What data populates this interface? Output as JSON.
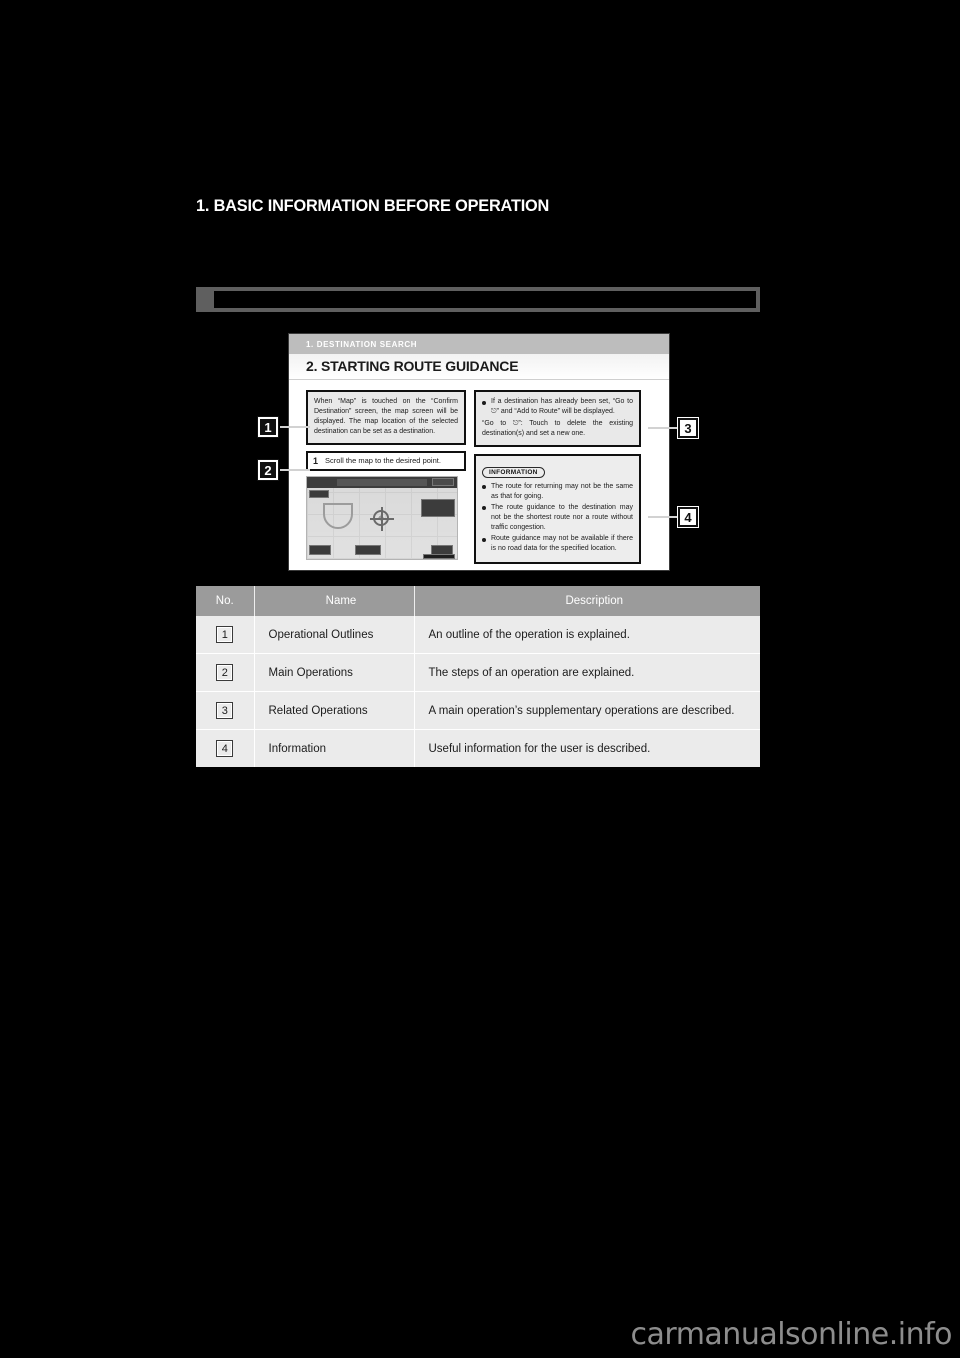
{
  "page": {
    "chapter_title": "1. BASIC INFORMATION BEFORE OPERATION",
    "section_heading": "",
    "watermark": "carmanualsonline.info"
  },
  "sample_page": {
    "subhead": "1. DESTINATION SEARCH",
    "title": "2. STARTING ROUTE GUIDANCE",
    "outline_text": "When “Map” is touched on the “Confirm Destination” screen, the map screen will be displayed. The map location of the selected destination can be set as a destination.",
    "step_number": "1",
    "step_text": "Scroll the map to the desired point.",
    "related_bullet": "If a destination has already been set, “Go to ⎋” and “Add to Route” will be displayed.",
    "related_note": "“Go to ⎋”: Touch to delete the existing destination(s) and set a new one.",
    "information_tag": "INFORMATION",
    "information_bullets": [
      "The route for returning may not be the same as that for going.",
      "The route guidance to the destination may not be the shortest route nor a route without traffic congestion.",
      "Route guidance may not be available if there is no road data for the specified location."
    ]
  },
  "callouts": [
    {
      "id": "1",
      "position": "left-top"
    },
    {
      "id": "2",
      "position": "left-bottom"
    },
    {
      "id": "3",
      "position": "right-top"
    },
    {
      "id": "4",
      "position": "right-bottom"
    }
  ],
  "legend_table": {
    "headers": [
      "No.",
      "Name",
      "Description"
    ],
    "rows": [
      {
        "no": "1",
        "name": "Operational Outlines",
        "description": "An outline of the operation is explained."
      },
      {
        "no": "2",
        "name": "Main Operations",
        "description": "The steps of an operation are explained."
      },
      {
        "no": "3",
        "name": "Related Operations",
        "description": "A main operation’s supplementary operations are described."
      },
      {
        "no": "4",
        "name": "Information",
        "description": "Useful information for the user is described."
      }
    ]
  },
  "colors": {
    "page_background": "#000000",
    "section_bar": "#5f5f5f",
    "table_header": "#9b9b9b",
    "table_row": "#ebebeb",
    "watermark": "#8d8d8d"
  }
}
